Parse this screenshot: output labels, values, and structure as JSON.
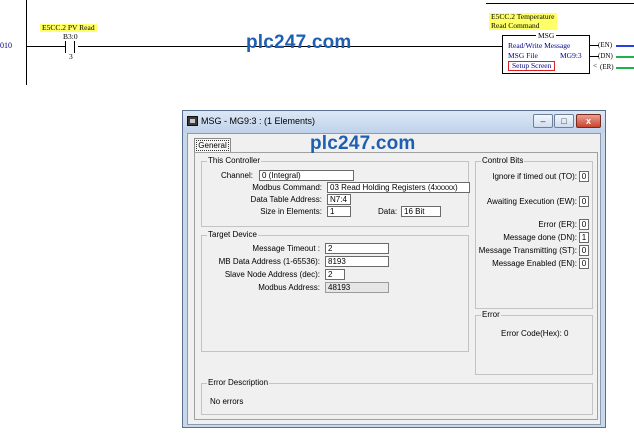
{
  "ladder": {
    "rung_number": "010",
    "left_label": {
      "line1": "E5CC.2 PV Read"
    },
    "contact": {
      "address": "B3:0",
      "bit": "3"
    },
    "right_label": {
      "line1": "E5CC.2 Temperature",
      "line2": "Read Command"
    },
    "msg_block": {
      "title": "MSG",
      "line1": "Read/Write Message",
      "line2_label": "MSG File",
      "line2_value": "MG9:3",
      "setup_button": "Setup Screen"
    },
    "coils": [
      "EN",
      "DN",
      "ER"
    ],
    "coil_colors": {
      "en": "#2a3fe0",
      "dn": "#22b14c",
      "er": "#22b14c"
    }
  },
  "watermark": "plc247.com",
  "window": {
    "title": "MSG - MG9:3 : (1 Elements)",
    "controls": {
      "minimize": "–",
      "maximize": "□",
      "close": "x"
    },
    "tab_general": "General",
    "this_controller": {
      "title": "This Controller",
      "channel_label": "Channel:",
      "channel_value": "0 (Integral)",
      "modbus_command_label": "Modbus Command:",
      "modbus_command_value": "03 Read Holding Registers (4xxxxx)",
      "data_table_label": "Data Table Address:",
      "data_table_value": "N7:4",
      "size_label": "Size in Elements:",
      "size_value": "1",
      "data_label": "Data:",
      "data_value": "16 Bit"
    },
    "target_device": {
      "title": "Target Device",
      "timeout_label": "Message Timeout :",
      "timeout_value": "2",
      "mb_address_label": "MB Data Address (1-65536):",
      "mb_address_value": "8193",
      "slave_label": "Slave Node Address (dec):",
      "slave_value": "2",
      "modbus_address_label": "Modbus Address:",
      "modbus_address_value": "48193"
    },
    "control_bits": {
      "title": "Control Bits",
      "items": [
        {
          "label": "Ignore if timed out (TO):",
          "value": "0"
        },
        {
          "label": "Awaiting Execution (EW):",
          "value": "0"
        },
        {
          "label": "Error (ER):",
          "value": "0"
        },
        {
          "label": "Message done (DN):",
          "value": "1"
        },
        {
          "label": "Message Transmitting (ST):",
          "value": "0"
        },
        {
          "label": "Message Enabled (EN):",
          "value": "0"
        }
      ]
    },
    "error": {
      "title": "Error",
      "code_label": "Error Code(Hex):",
      "code_value": "0"
    },
    "error_description": {
      "title": "Error Description",
      "text": "No errors"
    }
  }
}
